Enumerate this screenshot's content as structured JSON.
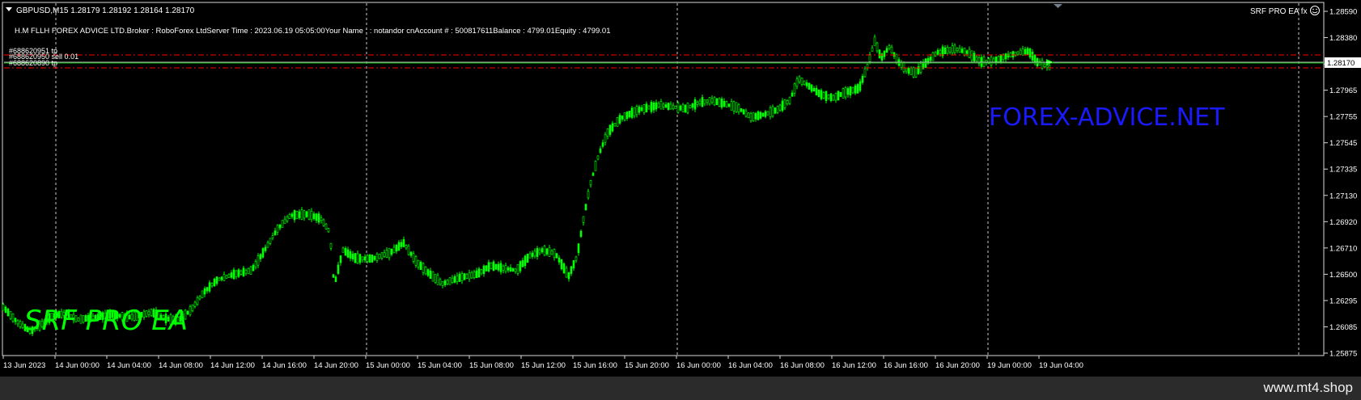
{
  "header": {
    "symbol_line": "GBPUSD,M15  1.28179 1.28192 1.28164 1.28170",
    "info_line": "H.M FLLH FOREX ADVICE LTD.Broker  : RoboForex LtdServer Time : 2023.06.19 05:05:00Your Name :   : notandor cnAccount #  : 500817611Balance : 4799.01Equity   : 4799.01",
    "ea_label": "SRF PRO EA  fx",
    "smiley_icon": "smiley-icon"
  },
  "orders": [
    {
      "label": "#688620951 tp"
    },
    {
      "label": "#688620950 sell 0.01"
    },
    {
      "label": "#688620890 tp"
    }
  ],
  "overlays": {
    "brand_left": "SRF PRO EA",
    "brand_right": "FOREX-ADVICE.NET",
    "footer": "www.mt4.shop"
  },
  "price_axis": {
    "labels": [
      "1.28590",
      "1.28380",
      "1.28170",
      "1.27965",
      "1.27755",
      "1.27545",
      "1.27335",
      "1.27130",
      "1.26920",
      "1.26710",
      "1.26500",
      "1.26295",
      "1.26085",
      "1.25875"
    ],
    "current_price": "1.28170"
  },
  "time_axis": {
    "labels": [
      "13 Jun 2023",
      "14 Jun 00:00",
      "14 Jun 04:00",
      "14 Jun 08:00",
      "14 Jun 12:00",
      "14 Jun 16:00",
      "14 Jun 20:00",
      "15 Jun 00:00",
      "15 Jun 04:00",
      "15 Jun 08:00",
      "15 Jun 12:00",
      "15 Jun 16:00",
      "15 Jun 20:00",
      "16 Jun 00:00",
      "16 Jun 04:00",
      "16 Jun 08:00",
      "16 Jun 12:00",
      "16 Jun 16:00",
      "16 Jun 20:00",
      "19 Jun 00:00",
      "19 Jun 04:00"
    ]
  },
  "colors": {
    "candles": "#00ff00",
    "order_lines": "#ff0000",
    "bid_line": "#c0c0c0",
    "brand_left": "#00ff00",
    "brand_right": "#1a1aff",
    "grid": "#c8c8c8"
  },
  "chart_data": {
    "type": "line",
    "ylim": [
      1.2579,
      1.2867
    ],
    "price_path": [
      [
        0,
        1.262
      ],
      [
        20,
        1.2605
      ],
      [
        35,
        1.2597
      ],
      [
        48,
        1.2603
      ],
      [
        60,
        1.261
      ],
      [
        75,
        1.2612
      ],
      [
        90,
        1.2607
      ],
      [
        110,
        1.2609
      ],
      [
        130,
        1.2611
      ],
      [
        150,
        1.2609
      ],
      [
        175,
        1.2613
      ],
      [
        190,
        1.2608
      ],
      [
        205,
        1.2606
      ],
      [
        220,
        1.2615
      ],
      [
        235,
        1.263
      ],
      [
        250,
        1.264
      ],
      [
        270,
        1.2645
      ],
      [
        290,
        1.2648
      ],
      [
        305,
        1.2665
      ],
      [
        320,
        1.2683
      ],
      [
        335,
        1.2694
      ],
      [
        355,
        1.2695
      ],
      [
        370,
        1.2691
      ],
      [
        380,
        1.268
      ],
      [
        385,
        1.2635
      ],
      [
        395,
        1.2665
      ],
      [
        410,
        1.2658
      ],
      [
        430,
        1.2658
      ],
      [
        450,
        1.2663
      ],
      [
        465,
        1.2671
      ],
      [
        480,
        1.2655
      ],
      [
        495,
        1.2645
      ],
      [
        510,
        1.2637
      ],
      [
        530,
        1.2642
      ],
      [
        550,
        1.2645
      ],
      [
        565,
        1.2652
      ],
      [
        580,
        1.265
      ],
      [
        595,
        1.2648
      ],
      [
        610,
        1.266
      ],
      [
        625,
        1.2665
      ],
      [
        640,
        1.2662
      ],
      [
        655,
        1.2643
      ],
      [
        665,
        1.266
      ],
      [
        672,
        1.269
      ],
      [
        680,
        1.272
      ],
      [
        690,
        1.2745
      ],
      [
        700,
        1.2763
      ],
      [
        715,
        1.2775
      ],
      [
        735,
        1.2782
      ],
      [
        760,
        1.2786
      ],
      [
        790,
        1.2783
      ],
      [
        805,
        1.2788
      ],
      [
        820,
        1.279
      ],
      [
        835,
        1.2787
      ],
      [
        850,
        1.2784
      ],
      [
        865,
        1.2776
      ],
      [
        880,
        1.2778
      ],
      [
        895,
        1.2782
      ],
      [
        910,
        1.279
      ],
      [
        920,
        1.2808
      ],
      [
        930,
        1.2803
      ],
      [
        945,
        1.2795
      ],
      [
        960,
        1.2792
      ],
      [
        975,
        1.2797
      ],
      [
        990,
        1.28
      ],
      [
        1000,
        1.282
      ],
      [
        1008,
        1.284
      ],
      [
        1015,
        1.2825
      ],
      [
        1025,
        1.2835
      ],
      [
        1035,
        1.2822
      ],
      [
        1045,
        1.2815
      ],
      [
        1055,
        1.2813
      ],
      [
        1065,
        1.282
      ],
      [
        1080,
        1.283
      ],
      [
        1100,
        1.2833
      ],
      [
        1115,
        1.283
      ],
      [
        1130,
        1.2822
      ],
      [
        1145,
        1.2823
      ],
      [
        1160,
        1.2827
      ],
      [
        1175,
        1.283
      ],
      [
        1185,
        1.2831
      ],
      [
        1195,
        1.2822
      ],
      [
        1210,
        1.2817
      ]
    ]
  }
}
